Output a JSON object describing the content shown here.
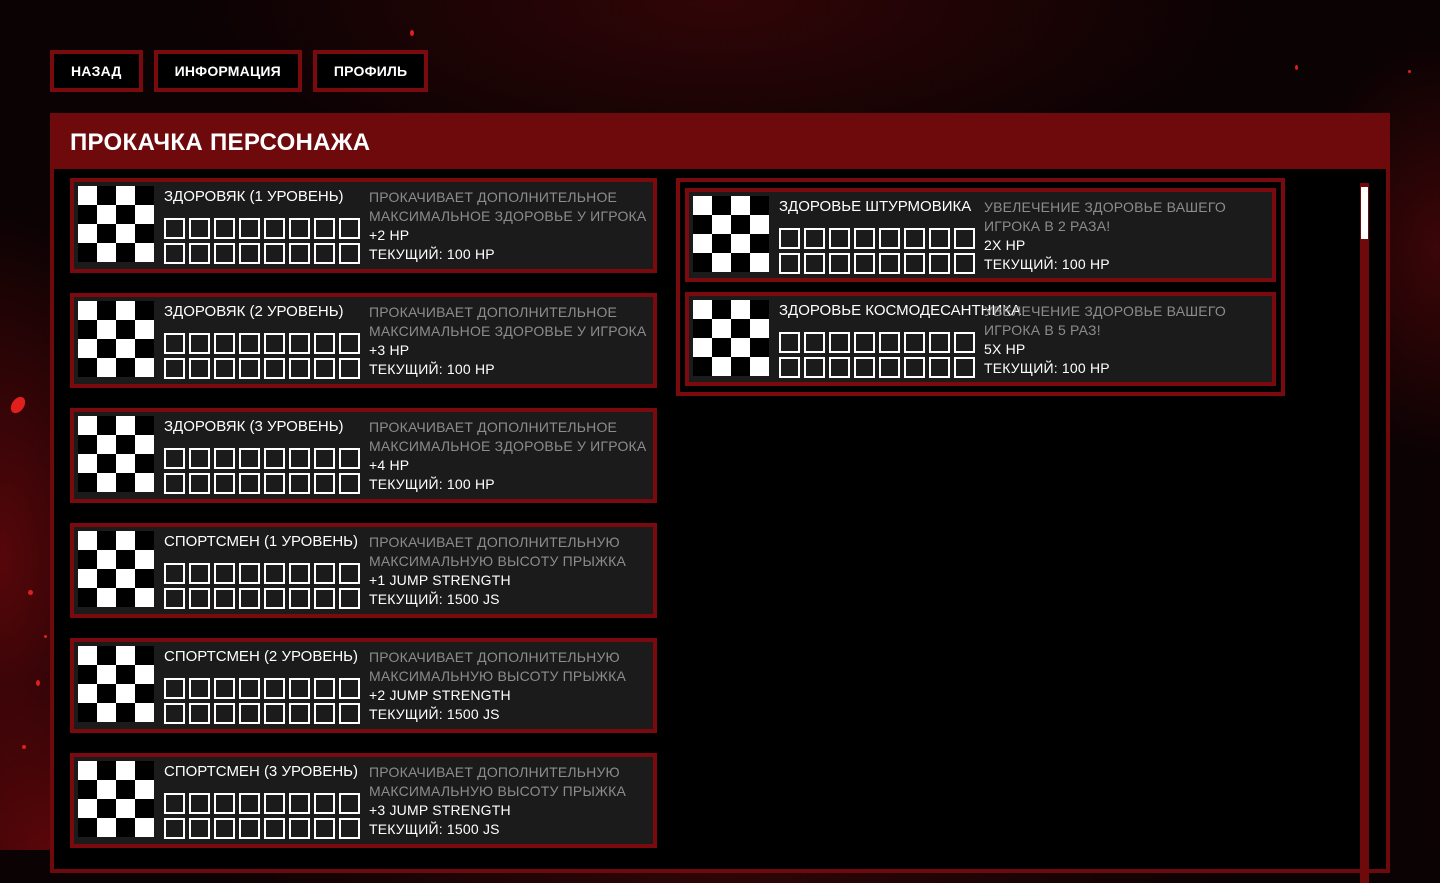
{
  "nav": {
    "back_label": "НАЗАД",
    "info_label": "ИНФОРМАЦИЯ",
    "profile_label": "ПРОФИЛЬ"
  },
  "panel": {
    "title": "ПРОКАЧКА ПЕРСОНАЖА"
  },
  "colors": {
    "accent_red": "#7a0a0d",
    "header_red": "#6e0a0c",
    "card_bg": "#1b1b1b",
    "desc_gray": "#8c8c8c"
  },
  "upgrades_left": [
    {
      "name": "ЗДОРОВЯК (1 УРОВЕНЬ)",
      "desc": "ПРОКАЧИВАЕТ ДОПОЛНИТЕЛЬНОЕ МАКСИМАЛЬНОЕ ЗДОРОВЬЕ У ИГРОКА",
      "bonus": "+2 HP",
      "current": "ТЕКУЩИЙ: 100 HP"
    },
    {
      "name": "ЗДОРОВЯК (2 УРОВЕНЬ)",
      "desc": "ПРОКАЧИВАЕТ ДОПОЛНИТЕЛЬНОЕ МАКСИМАЛЬНОЕ ЗДОРОВЬЕ У ИГРОКА",
      "bonus": "+3 HP",
      "current": "ТЕКУЩИЙ: 100 HP"
    },
    {
      "name": "ЗДОРОВЯК (3 УРОВЕНЬ)",
      "desc": "ПРОКАЧИВАЕТ ДОПОЛНИТЕЛЬНОЕ МАКСИМАЛЬНОЕ ЗДОРОВЬЕ У ИГРОКА",
      "bonus": "+4 HP",
      "current": "ТЕКУЩИЙ: 100 HP"
    },
    {
      "name": "СПОРТСМЕН (1 УРОВЕНЬ)",
      "desc": "ПРОКАЧИВАЕТ ДОПОЛНИТЕЛЬНУЮ МАКСИМАЛЬНУЮ ВЫСОТУ ПРЫЖКА",
      "bonus": "+1 JUMP STRENGTH",
      "current": "ТЕКУЩИЙ: 1500 JS"
    },
    {
      "name": "СПОРТСМЕН (2 УРОВЕНЬ)",
      "desc": "ПРОКАЧИВАЕТ ДОПОЛНИТЕЛЬНУЮ МАКСИМАЛЬНУЮ ВЫСОТУ ПРЫЖКА",
      "bonus": "+2 JUMP STRENGTH",
      "current": "ТЕКУЩИЙ: 1500 JS"
    },
    {
      "name": "СПОРТСМЕН (3 УРОВЕНЬ)",
      "desc": "ПРОКАЧИВАЕТ ДОПОЛНИТЕЛЬНУЮ МАКСИМАЛЬНУЮ ВЫСОТУ ПРЫЖКА",
      "bonus": "+3 JUMP STRENGTH",
      "current": "ТЕКУЩИЙ: 1500 JS"
    }
  ],
  "upgrades_right": [
    {
      "name": "ЗДОРОВЬЕ ШТУРМОВИКА",
      "desc": "УВЕЛЕЧЕНИЕ ЗДОРОВЬЕ ВАШЕГО ИГРОКА В 2 РАЗА!",
      "bonus": "2X HP",
      "current": "ТЕКУЩИЙ: 100 HP"
    },
    {
      "name": "ЗДОРОВЬЕ КОСМОДЕСАНТНИКА",
      "desc": "УВЕЛЕЧЕНИЕ ЗДОРОВЬЕ ВАШЕГО ИГРОКА В 5 РАЗ!",
      "bonus": "5X HP",
      "current": "ТЕКУЩИЙ: 100 HP"
    }
  ]
}
